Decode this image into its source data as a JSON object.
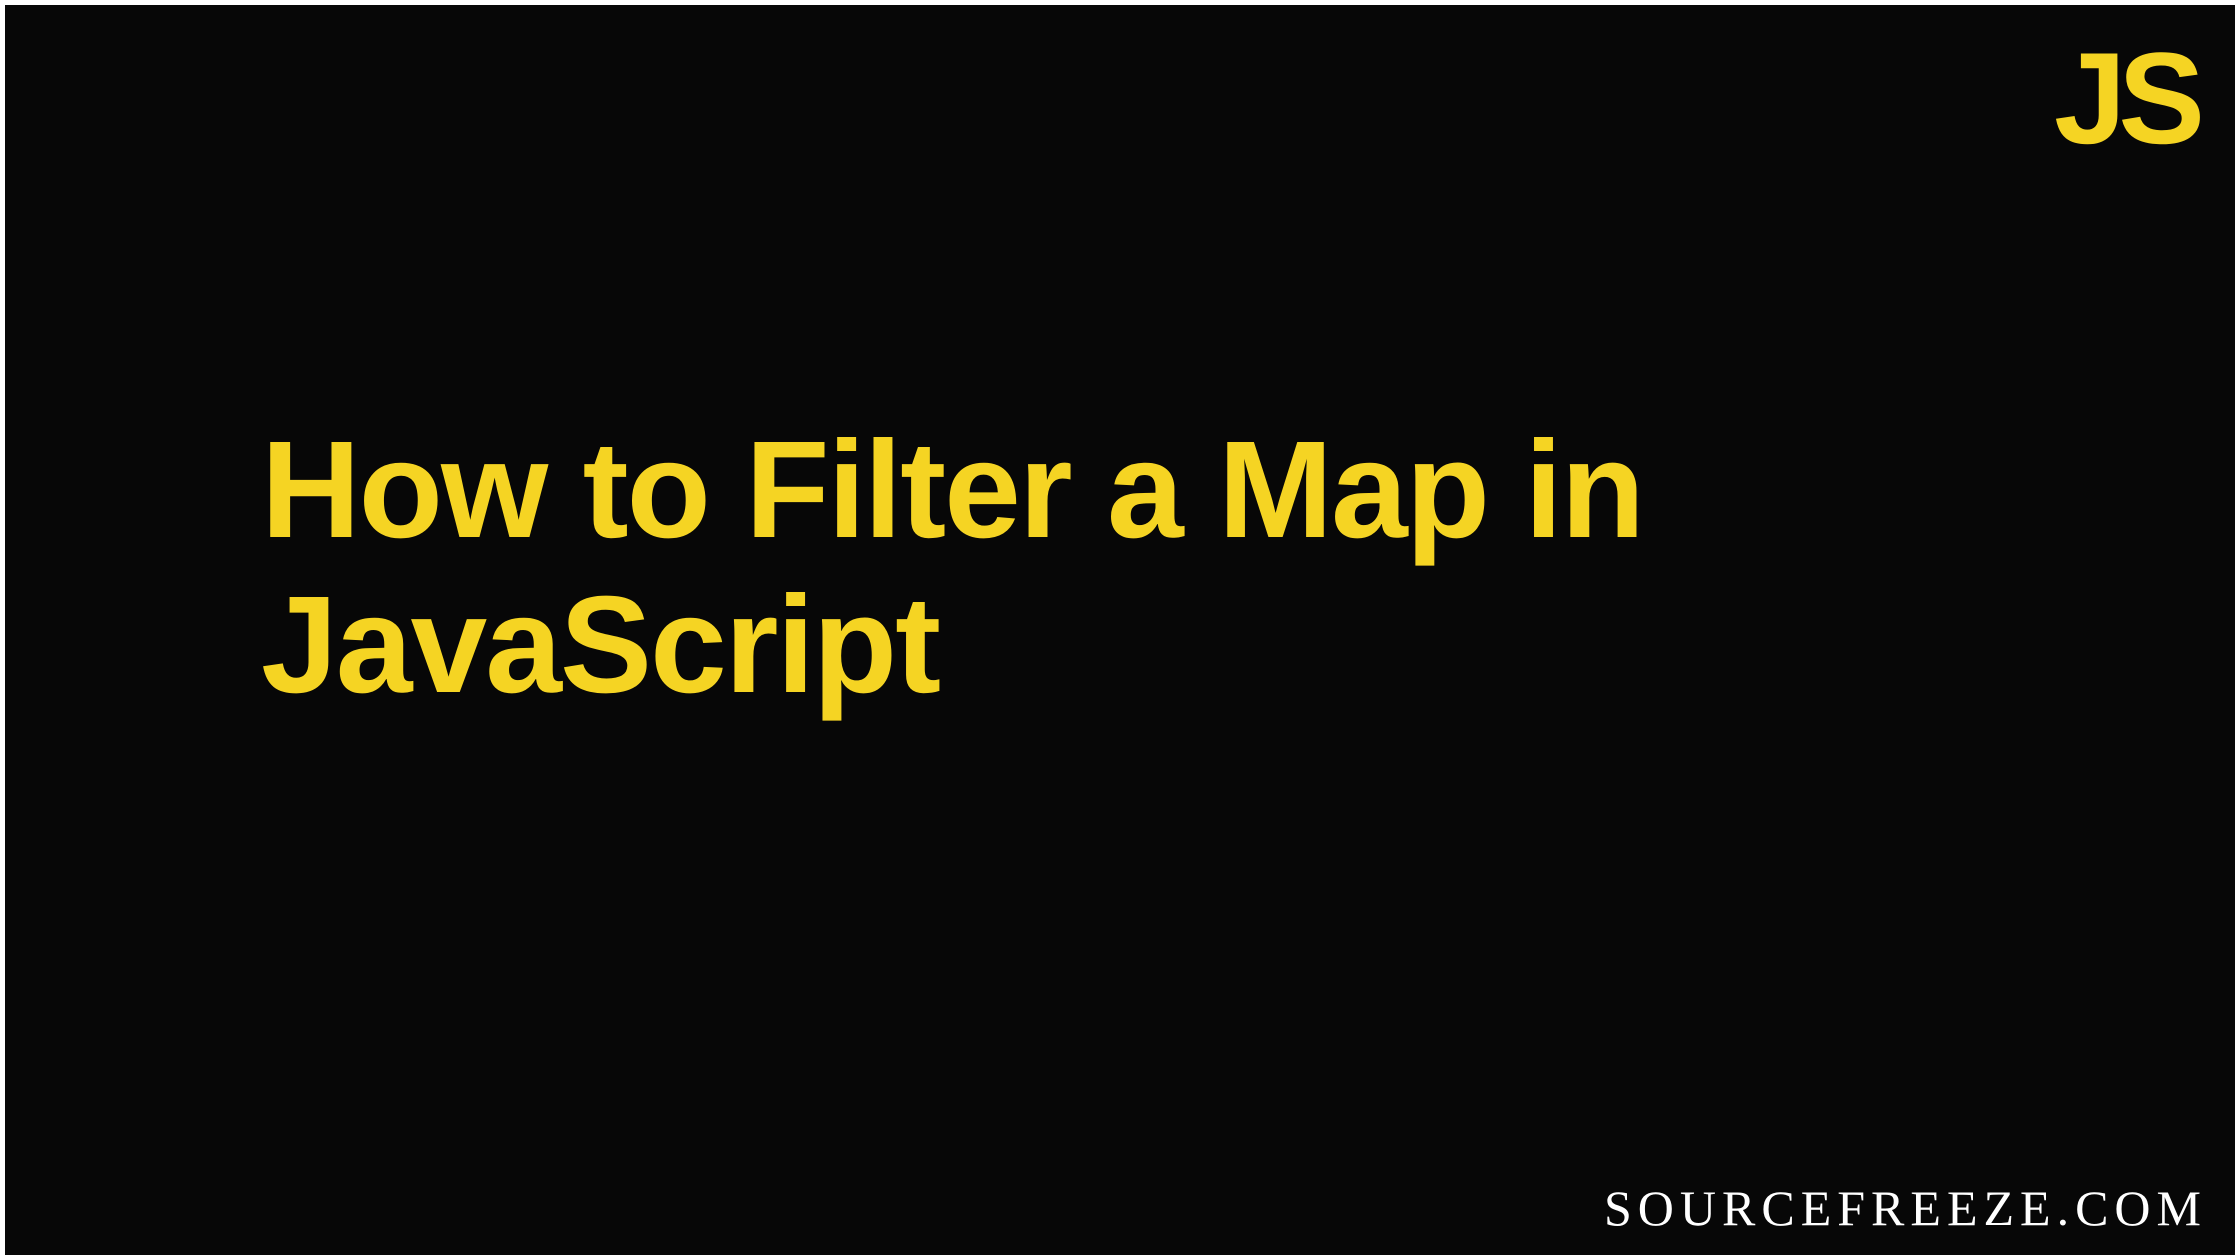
{
  "logo": "JS",
  "heading_line1": "How to Filter a Map in",
  "heading_line2": "JavaScript",
  "site_credit": "SOURCEFREEZE.COM"
}
